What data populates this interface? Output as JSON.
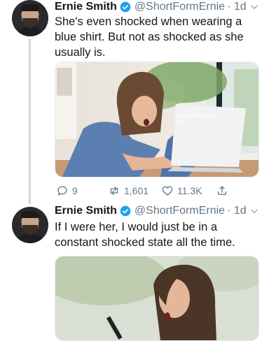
{
  "tweets": [
    {
      "name": "Ernie Smith",
      "handle": "@ShortFormErnie",
      "time": "· 1d",
      "text": "She's even shocked when wearing a\nblue shirt. But not as shocked as she\nusually is.",
      "media_watermark": "gettyimages",
      "media_watermark_sub": "Antonio Guillem",
      "actions": {
        "replies": "9",
        "retweets": "1,601",
        "likes": "11.3K"
      }
    },
    {
      "name": "Ernie Smith",
      "handle": "@ShortFormErnie",
      "time": "· 1d",
      "text": "If I were her, I would just be in a\nconstant shocked state all the time."
    }
  ],
  "colors": {
    "verified": "#1da1f2",
    "secondary_text": "#657786",
    "thread_line": "#cdd6dd"
  },
  "icons": [
    "verified-badge-icon",
    "chevron-down-icon",
    "reply-icon",
    "retweet-icon",
    "like-icon",
    "share-icon"
  ]
}
